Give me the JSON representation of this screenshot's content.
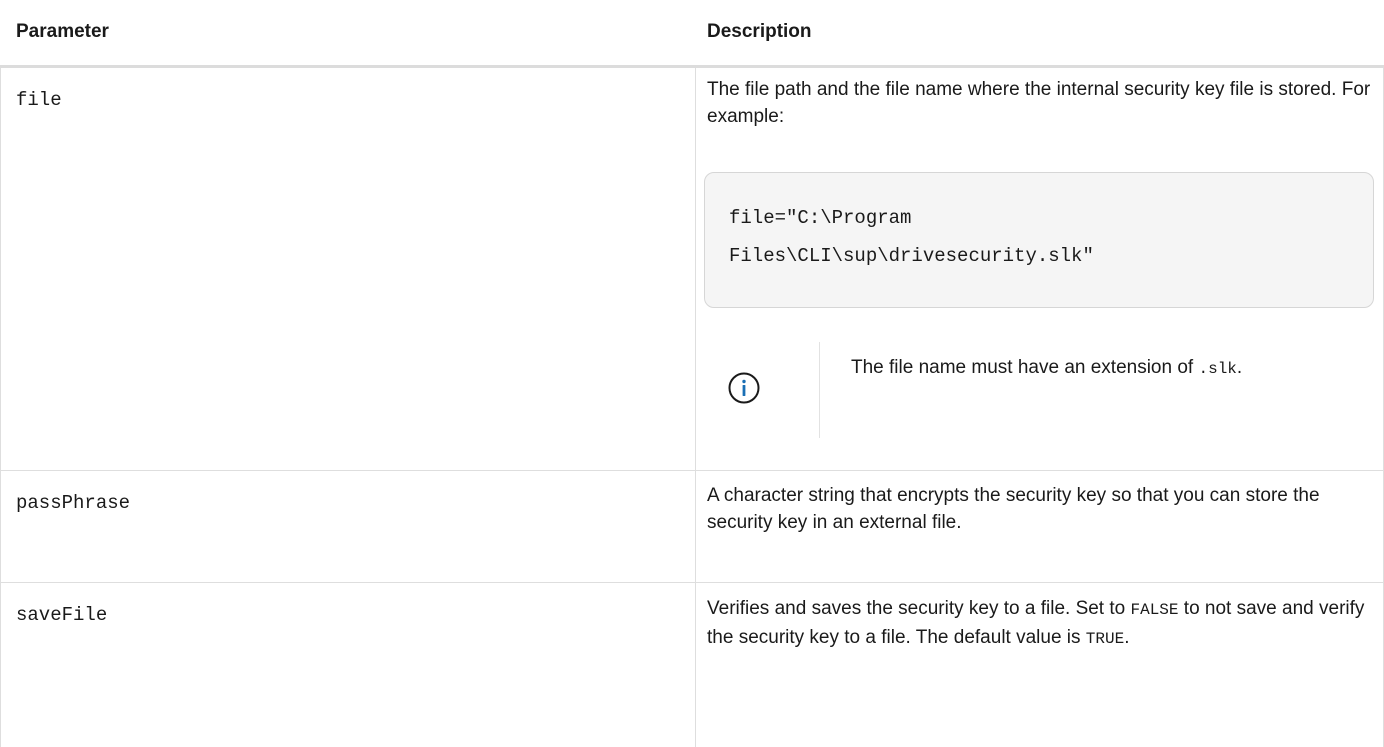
{
  "table": {
    "headers": {
      "parameter": "Parameter",
      "description": "Description"
    },
    "rows": [
      {
        "name": "file",
        "description": "The file path and the file name where the internal security key file is stored. For example:",
        "code_lines": [
          "file=\"C:\\Program",
          "Files\\CLI\\sup\\drivesecurity.slk\""
        ],
        "note": {
          "icon": "info-icon",
          "text_before": "The file name must have an extension of ",
          "code": ".slk",
          "text_after": "."
        }
      },
      {
        "name": "passPhrase",
        "description": "A character string that encrypts the security key so that you can store the security key in an external file."
      },
      {
        "name": "saveFile",
        "description_part1": "Verifies and saves the security key to a file. Set to ",
        "code1": "FALSE",
        "description_part2": " to not save and verify the security key to a file. The default value is ",
        "code2": "TRUE",
        "description_part3": "."
      }
    ]
  },
  "colors": {
    "border": "#dedede",
    "code_background": "#f5f5f5",
    "info_icon": "#1a6fb5",
    "text": "#1a1a1a"
  }
}
